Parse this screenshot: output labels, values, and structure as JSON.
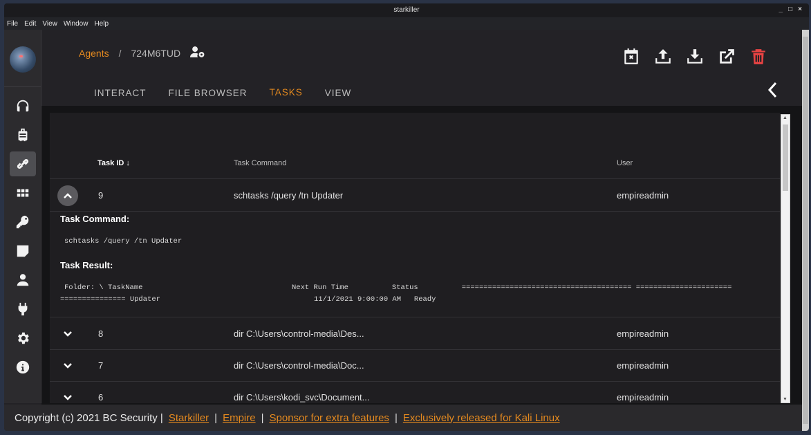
{
  "window": {
    "title": "starkiller",
    "controls": [
      "_",
      "□",
      "×"
    ]
  },
  "menu": [
    "File",
    "Edit",
    "View",
    "Window",
    "Help"
  ],
  "sidebar": {
    "items": [
      {
        "name": "listeners",
        "icon": "headphones-icon"
      },
      {
        "name": "stagers",
        "icon": "luggage-icon"
      },
      {
        "name": "agents",
        "icon": "link-icon",
        "active": true
      },
      {
        "name": "modules",
        "icon": "grid-icon"
      },
      {
        "name": "credentials",
        "icon": "key-icon"
      },
      {
        "name": "reporting",
        "icon": "note-icon"
      },
      {
        "name": "users",
        "icon": "user-icon"
      },
      {
        "name": "plugins",
        "icon": "plug-icon"
      },
      {
        "name": "settings",
        "icon": "gear-icon"
      },
      {
        "name": "about",
        "icon": "info-icon"
      }
    ]
  },
  "breadcrumb": {
    "parent": "Agents",
    "separator": "/",
    "current": "724M6TUD"
  },
  "toolbar": [
    "clear-tasks",
    "upload",
    "download",
    "open-new-window",
    "kill-agent"
  ],
  "tabs": [
    {
      "label": "INTERACT"
    },
    {
      "label": "FILE BROWSER"
    },
    {
      "label": "TASKS",
      "active": true
    },
    {
      "label": "VIEW"
    }
  ],
  "table": {
    "headers": {
      "id": "Task ID",
      "command": "Task Command",
      "user": "User"
    },
    "sort_indicator": "↓",
    "rows": [
      {
        "id": "9",
        "command": "schtasks /query /tn Updater",
        "user": "empireadmin",
        "expanded": true
      },
      {
        "id": "8",
        "command": "dir C:\\Users\\control-media\\Des...",
        "user": "empireadmin"
      },
      {
        "id": "7",
        "command": "dir C:\\Users\\control-media\\Doc...",
        "user": "empireadmin"
      },
      {
        "id": "6",
        "command": "dir C:\\Users\\kodi_svc\\Document...",
        "user": "empireadmin"
      }
    ],
    "detail": {
      "command_label": "Task Command:",
      "command_text": "schtasks /query /tn Updater",
      "result_label": "Task Result:",
      "result_line1_a": "Folder: \\ TaskName",
      "result_line1_b": "Next Run Time          Status          ======================================= ======================",
      "result_line2_a": "=============== Updater",
      "result_line2_b": "11/1/2021 9:00:00 AM   Ready"
    }
  },
  "footer": {
    "copyright": "Copyright (c) 2021 BC Security |",
    "links": [
      "Starkiller",
      "Empire",
      "Sponsor for extra features",
      "Exclusively released for Kali Linux"
    ],
    "separator": "|"
  },
  "colors": {
    "accent": "#e58a1f",
    "danger": "#e84343",
    "background": "#232226"
  }
}
